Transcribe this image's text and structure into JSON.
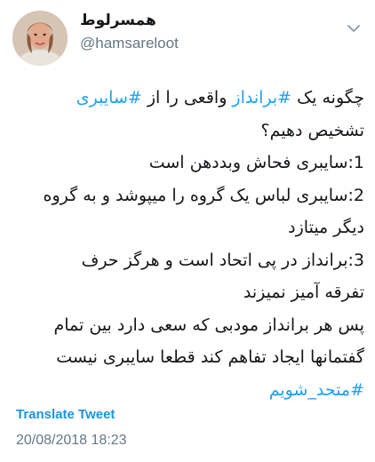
{
  "user": {
    "display_name": "همسرلوط",
    "handle": "@hamsareloot"
  },
  "icons": {
    "avatar": "profile-photo",
    "menu": "chevron-down-icon"
  },
  "tweet": {
    "line1": {
      "pre": "چگونه یک ",
      "hashtag1": "#برانداز",
      "mid": " واقعی را از ",
      "hashtag2": "#سایبری"
    },
    "line2": "تشخیص دهیم؟",
    "line3": "1:سایبری فحاش وبددهن است",
    "line4": "2:سایبری لباس یک گروه را میپوشد و به گروه",
    "line5": "دیگر میتازد",
    "line6": "3:برانداز در پی اتحاد است و هرگز حرف",
    "line7": "تفرقه آمیز نمیزند",
    "line8": "پس هر برانداز مودبی که سعی دارد بین تمام",
    "line9": "گفتمانها ایجاد تفاهم کند قطعا سایبری نیست",
    "hashtag3": "#متحد_شویم"
  },
  "translate_label": "Translate Tweet",
  "timestamp": "20/08/2018 18:23",
  "colors": {
    "link": "#1da1f2",
    "muted": "#657786",
    "text": "#14171a"
  }
}
